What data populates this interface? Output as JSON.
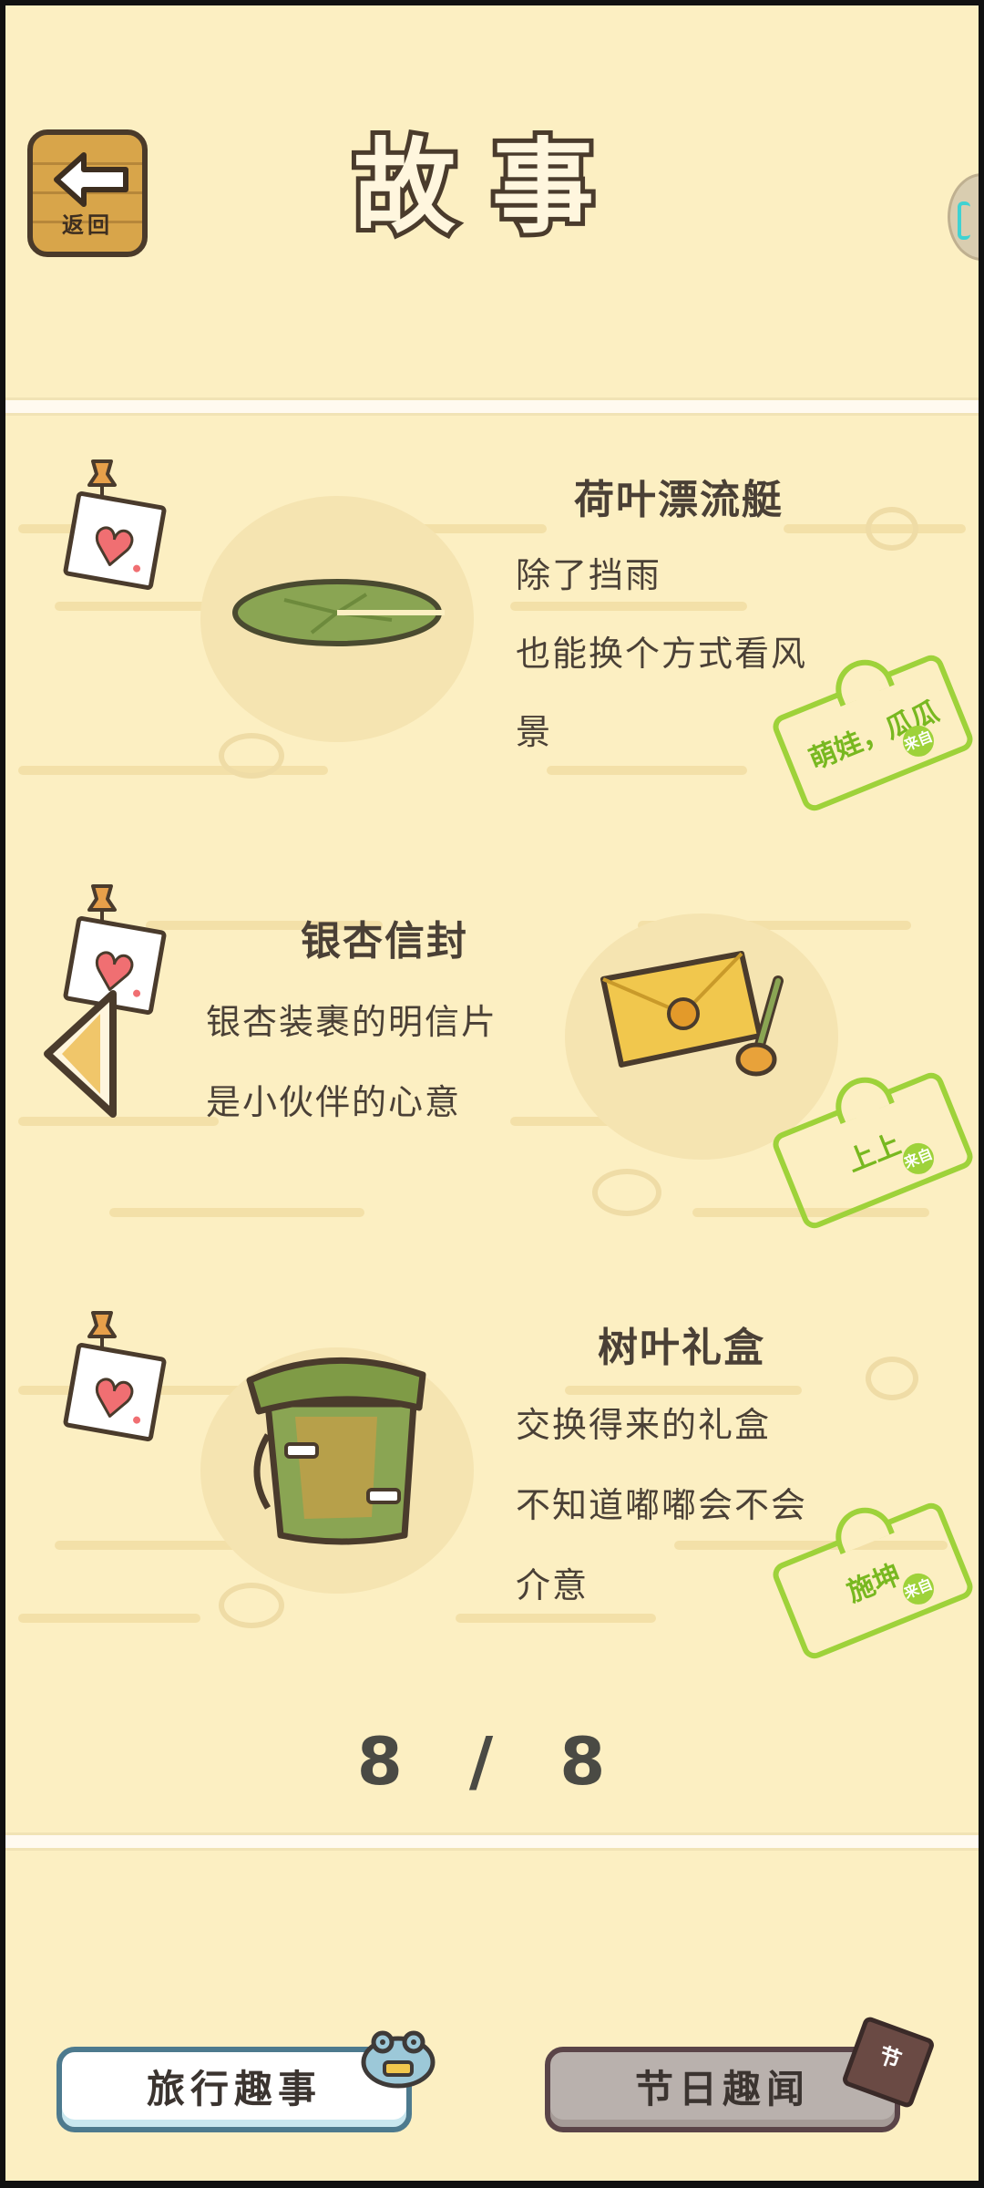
{
  "header": {
    "back_label": "返回",
    "title": "故事"
  },
  "stories": [
    {
      "title": "荷叶漂流艇",
      "lines": [
        "除了挡雨",
        "也能换个方式看风",
        "景"
      ],
      "stamp_name": "萌娃，瓜瓜",
      "stamp_from": "来自"
    },
    {
      "title": "银杏信封",
      "lines": [
        "银杏装裹的明信片",
        "是小伙伴的心意"
      ],
      "stamp_name": "上上",
      "stamp_from": "来自"
    },
    {
      "title": "树叶礼盒",
      "lines": [
        "交换得来的礼盒",
        "不知道嘟嘟会不会",
        "介意"
      ],
      "stamp_name": "施坤",
      "stamp_from": "来自"
    }
  ],
  "pager": {
    "text": "8 / 8"
  },
  "bottom": {
    "travel_label": "旅行趣事",
    "festival_label": "节日趣闻",
    "festival_badge": "节"
  },
  "colors": {
    "background": "#fcefc2",
    "stamp_green": "#9ed23a",
    "heart_red": "#f06f72"
  },
  "icons": [
    "back-arrow-icon",
    "heart-icon",
    "pushpin-icon",
    "lily-pad-icon",
    "ginkgo-envelope-icon",
    "leaf-gift-box-icon",
    "left-arrow-icon",
    "frog-stamp-icon"
  ]
}
